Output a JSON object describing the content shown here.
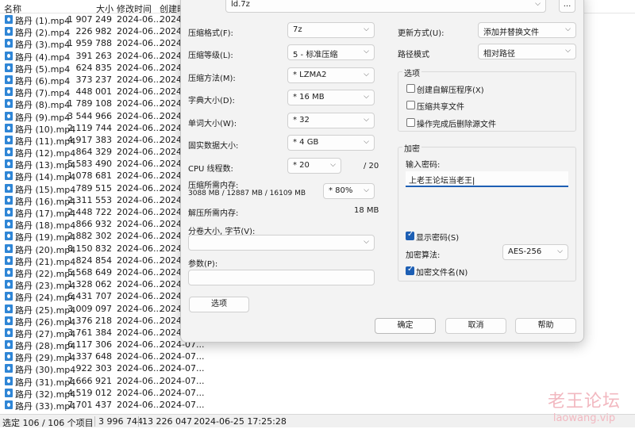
{
  "file_list": {
    "headers": {
      "name": "名称",
      "size": "大小",
      "modified": "修改时间",
      "created": "创建时"
    },
    "rows": [
      {
        "name": "路丹 (1).mp4",
        "size": "1 907 249",
        "modified": "2024-06...",
        "created": "2024"
      },
      {
        "name": "路丹 (2).mp4",
        "size": "226 982",
        "modified": "2024-06...",
        "created": "2024"
      },
      {
        "name": "路丹 (3).mp4",
        "size": "1 959 788",
        "modified": "2024-06...",
        "created": "2024"
      },
      {
        "name": "路丹 (4).mp4",
        "size": "391 263",
        "modified": "2024-06...",
        "created": "2024"
      },
      {
        "name": "路丹 (5).mp4",
        "size": "624 835",
        "modified": "2024-06...",
        "created": "2024"
      },
      {
        "name": "路丹 (6).mp4",
        "size": "373 237",
        "modified": "2024-06...",
        "created": "2024"
      },
      {
        "name": "路丹 (7).mp4",
        "size": "448 001",
        "modified": "2024-06...",
        "created": "2024"
      },
      {
        "name": "路丹 (8).mp4",
        "size": "1 789 108",
        "modified": "2024-06...",
        "created": "2024"
      },
      {
        "name": "路丹 (9).mp4",
        "size": "3 544 966",
        "modified": "2024-06...",
        "created": "2024"
      },
      {
        "name": "路丹 (10).mp4",
        "size": "2 119 744",
        "modified": "2024-06...",
        "created": "2024"
      },
      {
        "name": "路丹 (11).mp4",
        "size": "4 917 383",
        "modified": "2024-06...",
        "created": "2024"
      },
      {
        "name": "路丹 (12).mp4",
        "size": "864 329",
        "modified": "2024-06...",
        "created": "2024"
      },
      {
        "name": "路丹 (13).mp4",
        "size": "5 583 490",
        "modified": "2024-06...",
        "created": "2024"
      },
      {
        "name": "路丹 (14).mp4",
        "size": "1 078 681",
        "modified": "2024-06...",
        "created": "2024"
      },
      {
        "name": "路丹 (15).mp4",
        "size": "789 515",
        "modified": "2024-06...",
        "created": "2024"
      },
      {
        "name": "路丹 (16).mp4",
        "size": "2 311 553",
        "modified": "2024-06...",
        "created": "2024"
      },
      {
        "name": "路丹 (17).mp4",
        "size": "2 448 722",
        "modified": "2024-06...",
        "created": "2024"
      },
      {
        "name": "路丹 (18).mp4",
        "size": "866 932",
        "modified": "2024-06...",
        "created": "2024"
      },
      {
        "name": "路丹 (19).mp4",
        "size": "2 882 302",
        "modified": "2024-06...",
        "created": "2024"
      },
      {
        "name": "路丹 (20).mp4",
        "size": "8 150 832",
        "modified": "2024-06...",
        "created": "2024"
      },
      {
        "name": "路丹 (21).mp4",
        "size": "824 854",
        "modified": "2024-06...",
        "created": "2024"
      },
      {
        "name": "路丹 (22).mp4",
        "size": "5 568 649",
        "modified": "2024-06...",
        "created": "2024"
      },
      {
        "name": "路丹 (23).mp4",
        "size": "1 328 062",
        "modified": "2024-06...",
        "created": "2024"
      },
      {
        "name": "路丹 (24).mp4",
        "size": "6 431 707",
        "modified": "2024-06...",
        "created": "2024"
      },
      {
        "name": "路丹 (25).mp4",
        "size": "3 009 097",
        "modified": "2024-06...",
        "created": "2024"
      },
      {
        "name": "路丹 (26).mp4",
        "size": "1 376 218",
        "modified": "2024-06...",
        "created": "2024"
      },
      {
        "name": "路丹 (27).mp4",
        "size": "3 761 384",
        "modified": "2024-06...",
        "created": "2024"
      },
      {
        "name": "路丹 (28).mp4",
        "size": "6 117 306",
        "modified": "2024-06...",
        "created": "2024-07..."
      },
      {
        "name": "路丹 (29).mp4",
        "size": "1 337 648",
        "modified": "2024-06...",
        "created": "2024-07..."
      },
      {
        "name": "路丹 (30).mp4",
        "size": "922 303",
        "modified": "2024-06...",
        "created": "2024-07..."
      },
      {
        "name": "路丹 (31).mp4",
        "size": "7 666 921",
        "modified": "2024-06...",
        "created": "2024-07..."
      },
      {
        "name": "路丹 (32).mp4",
        "size": "4 519 012",
        "modified": "2024-06...",
        "created": "2024-07..."
      },
      {
        "name": "路丹 (33).mp4",
        "size": "7 701 437",
        "modified": "2024-06...",
        "created": "2024-07..."
      }
    ]
  },
  "status_bar": {
    "selection": "选定 106 / 106 个项目",
    "size": "3 996 744",
    "total": "13 226 047",
    "datetime": "2024-06-25 17:25:28"
  },
  "dialog": {
    "archive_name": "ld.7z",
    "browse_label": "...",
    "format_label": "压缩格式(F):",
    "format_value": "7z",
    "level_label": "压缩等级(L):",
    "level_value": "5 - 标准压缩",
    "method_label": "压缩方法(M):",
    "method_value": "* LZMA2",
    "dict_label": "字典大小(D):",
    "dict_value": "* 16 MB",
    "word_label": "单词大小(W):",
    "word_value": "* 32",
    "solid_label": "固实数据大小:",
    "solid_value": "* 4 GB",
    "threads_label": "CPU 线程数:",
    "threads_value": "* 20",
    "threads_max": "/ 20",
    "mem_comp_label": "压缩所需内存:",
    "mem_comp_detail": "3088 MB / 12887 MB / 16109 MB",
    "mem_comp_value": "* 80%",
    "mem_decomp_label": "解压所需内存:",
    "mem_decomp_value": "18 MB",
    "split_label": "分卷大小, 字节(V):",
    "split_value": "",
    "params_label": "参数(P):",
    "params_value": "",
    "options_button": "选项",
    "update_label": "更新方式(U):",
    "update_value": "添加并替换文件",
    "path_label": "路径模式",
    "path_value": "相对路径",
    "options_group": "选项",
    "opt_sfx": "创建自解压程序(X)",
    "opt_shared": "压缩共享文件",
    "opt_delete": "操作完成后删除源文件",
    "encryption_group": "加密",
    "password_label": "输入密码:",
    "password_value": "上老王论坛当老王",
    "show_password": "显示密码(S)",
    "enc_method_label": "加密算法:",
    "enc_method_value": "AES-256",
    "encrypt_names": "加密文件名(N)",
    "ok_button": "确定",
    "cancel_button": "取消",
    "help_button": "帮助"
  },
  "watermark": {
    "line1": "老王论坛",
    "line2": "laowang.vip"
  }
}
